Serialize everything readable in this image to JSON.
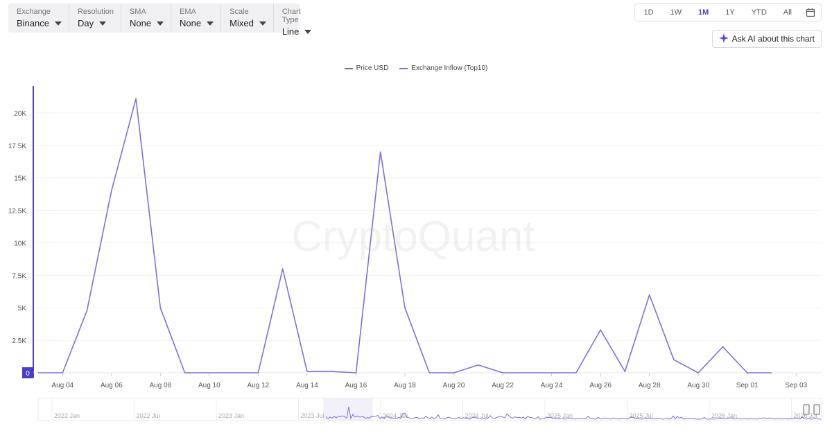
{
  "toolbar": {
    "items": [
      {
        "label": "Exchange",
        "value": "Binance"
      },
      {
        "label": "Resolution",
        "value": "Day"
      },
      {
        "label": "SMA",
        "value": "None"
      },
      {
        "label": "EMA",
        "value": "None"
      },
      {
        "label": "Scale",
        "value": "Mixed"
      },
      {
        "label": "Chart Type",
        "value": "Line"
      }
    ]
  },
  "ranges": {
    "options": [
      "1D",
      "1W",
      "1M",
      "1Y",
      "YTD",
      "All"
    ],
    "active": "1M"
  },
  "ask_ai": {
    "label": "Ask AI about this chart"
  },
  "watermark": "CryptoQuant",
  "colors": {
    "accent": "#4a3ec9",
    "series_line": "#7b6fe0",
    "price_line": "#6b6b7b",
    "grid": "#f1f1f4"
  },
  "chart_data": {
    "type": "line",
    "legend": [
      {
        "name": "Price USD",
        "color": "#6b6b7b"
      },
      {
        "name": "Exchange Inflow (Top10)",
        "color": "#7b6fe0"
      }
    ],
    "x": [
      "Aug 03",
      "Aug 04",
      "Aug 05",
      "Aug 06",
      "Aug 07",
      "Aug 08",
      "Aug 09",
      "Aug 10",
      "Aug 11",
      "Aug 12",
      "Aug 13",
      "Aug 14",
      "Aug 15",
      "Aug 16",
      "Aug 17",
      "Aug 18",
      "Aug 19",
      "Aug 20",
      "Aug 21",
      "Aug 22",
      "Aug 23",
      "Aug 24",
      "Aug 25",
      "Aug 26",
      "Aug 27",
      "Aug 28",
      "Aug 29",
      "Aug 30",
      "Aug 31",
      "Sep 01",
      "Sep 02"
    ],
    "series": [
      {
        "name": "Exchange Inflow (Top10)",
        "values": [
          0,
          0,
          4800,
          14000,
          21100,
          5000,
          0,
          0,
          0,
          0,
          8000,
          100,
          100,
          0,
          17000,
          5000,
          0,
          0,
          600,
          0,
          0,
          0,
          0,
          3300,
          100,
          6000,
          1000,
          0,
          2000,
          0,
          0
        ]
      }
    ],
    "x_ticks": [
      "Aug 04",
      "Aug 06",
      "Aug 08",
      "Aug 10",
      "Aug 12",
      "Aug 14",
      "Aug 16",
      "Aug 18",
      "Aug 20",
      "Aug 22",
      "Aug 24",
      "Aug 26",
      "Aug 28",
      "Aug 30",
      "Sep 01",
      "Sep 03"
    ],
    "y_ticks": [
      "0",
      "2.5K",
      "5K",
      "7.5K",
      "10K",
      "12.5K",
      "15K",
      "17.5K",
      "20K"
    ],
    "y_tick_values": [
      0,
      2500,
      5000,
      7500,
      10000,
      12500,
      15000,
      17500,
      20000
    ],
    "ylim": [
      0,
      22500
    ],
    "navigator": {
      "labels": [
        "2022 Jan",
        "2022 Jul",
        "2023 Jan",
        "2023 Jul",
        "2024 Jan",
        "2024 Jul",
        "2025 Jan",
        "2025 Jul",
        "2026 Jan",
        "2026 Jul"
      ]
    }
  }
}
